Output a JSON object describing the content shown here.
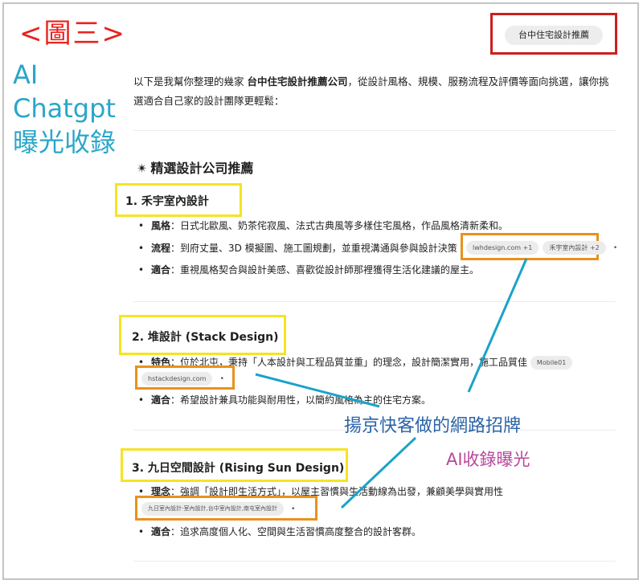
{
  "figure_label": "<圖三>",
  "side_note": [
    "AI",
    "Chatgpt",
    "曝光收錄"
  ],
  "query_chip": "台中住宅設計推薦",
  "intro": {
    "before": "以下是我幫你整理的幾家 ",
    "bold": "台中住宅設計推薦公司",
    "after": "，從設計風格、規模、服務流程及評價等面向挑選，讓你挑選適合自己家的設計團隊更輕鬆："
  },
  "section_title": "精選設計公司推薦",
  "section_icon": "sparkle-icon",
  "companies": [
    {
      "name": "1. 禾宇室內設計",
      "bullets": [
        {
          "label": "風格",
          "text": "：日式北歐風、奶茶侘寂風、法式古典風等多樣住宅風格，作品風格清新柔和。"
        },
        {
          "label": "流程",
          "text": "：到府丈量、3D 模擬圖、施工圖規劃，並重視溝通與參與設計決策"
        },
        {
          "label": "適合",
          "text": "：重視風格契合與設計美感、喜歡從設計師那裡獲得生活化建議的屋主。"
        }
      ],
      "sources": [
        "lwhdesign.com +1",
        "禾宇室內設計 +2"
      ]
    },
    {
      "name": "2. 堆設計 (Stack Design)",
      "bullets": [
        {
          "label": "特色",
          "text": "：位於北屯，秉持「人本設計與工程品質並重」的理念，設計簡潔實用，施工品質佳"
        },
        {
          "label": "適合",
          "text": "：希望設計兼具功能與耐用性，以簡約風格為主的住宅方案。"
        }
      ],
      "inline_source": "Mobile01",
      "sources": [
        "hstackdesign.com"
      ]
    },
    {
      "name": "3. 九日空間設計 (Rising Sun Design)",
      "bullets": [
        {
          "label": "理念",
          "text": "：強調「設計即生活方式」，以屋主習慣與生活動線為出發，兼顧美學與實用性"
        },
        {
          "label": "適合",
          "text": "：追求高度個人化、空間與生活習慣高度整合的設計客群。"
        }
      ],
      "sources": [
        "九日室內設計-室內設計,台中室內設計,南屯室內設計"
      ]
    }
  ],
  "annotation_main": "揚京快客做的網路招牌",
  "annotation_sub": "AI收錄曝光",
  "colors": {
    "figure_label": "#e8231f",
    "side_note": "#2aa6c9",
    "query_box": "#cc1f1f",
    "name_box": "#f5e423",
    "source_box": "#e8921c",
    "annotation_main": "#2a63a8",
    "annotation_sub": "#b9479c",
    "pointer_line": "#1aa3c9"
  }
}
